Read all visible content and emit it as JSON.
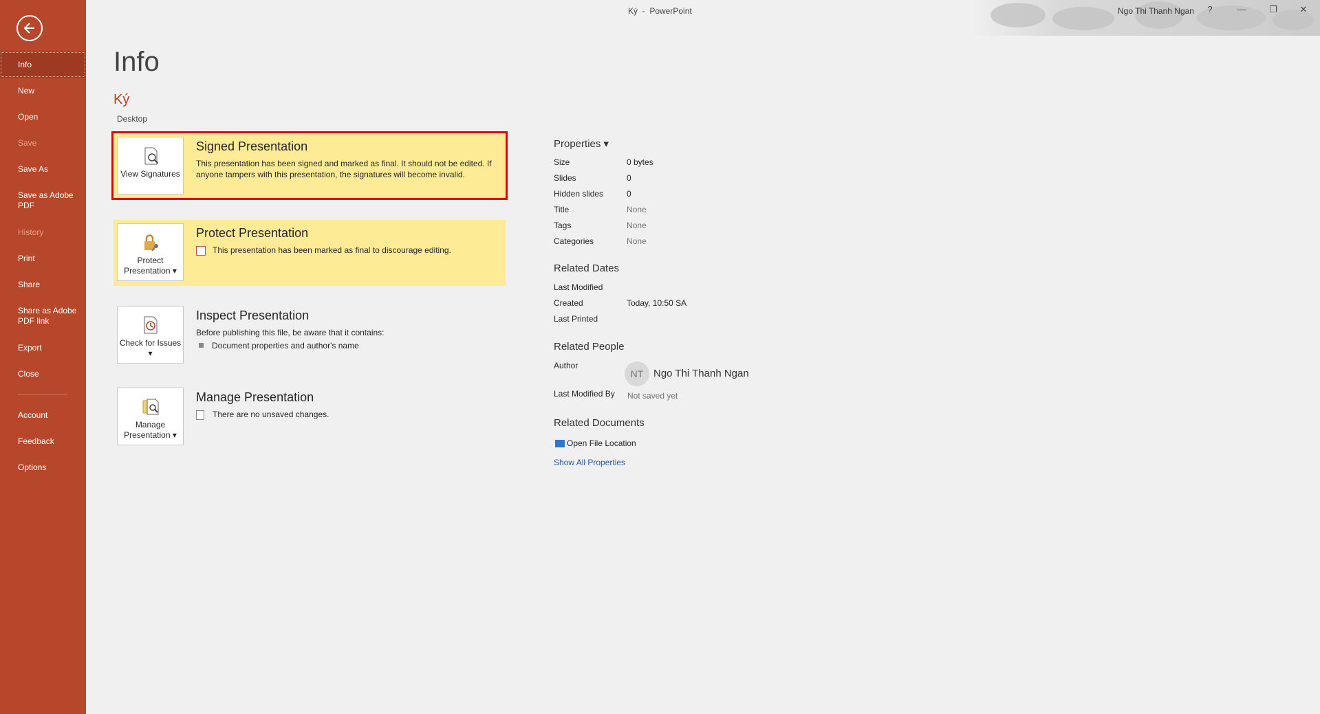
{
  "window": {
    "title": "Ký  -  PowerPoint",
    "user": "Ngo Thi Thanh Ngan",
    "help": "?",
    "minimize": "—",
    "restore": "❐",
    "close": "✕"
  },
  "nav": {
    "items": [
      {
        "label": "Info"
      },
      {
        "label": "New"
      },
      {
        "label": "Open"
      },
      {
        "label": "Save"
      },
      {
        "label": "Save As"
      },
      {
        "label": "Save as Adobe PDF"
      },
      {
        "label": "History"
      },
      {
        "label": "Print"
      },
      {
        "label": "Share"
      },
      {
        "label": "Share as Adobe PDF link"
      },
      {
        "label": "Export"
      },
      {
        "label": "Close"
      },
      {
        "label": "Account"
      },
      {
        "label": "Feedback"
      },
      {
        "label": "Options"
      }
    ]
  },
  "page": {
    "title": "Info",
    "file_name": "Ký",
    "location": "Desktop"
  },
  "sections": {
    "signed": {
      "button": "View Signatures",
      "title": "Signed Presentation",
      "body": "This presentation has been signed and marked as final. It should not be edited. If anyone tampers with this presentation, the signatures will become invalid."
    },
    "protect": {
      "button": "Protect Presentation ▾",
      "title": "Protect Presentation",
      "body": "This presentation has been marked as final to discourage editing."
    },
    "inspect": {
      "button": "Check for Issues ▾",
      "title": "Inspect Presentation",
      "body": "Before publishing this file, be aware that it contains:",
      "bullet": "Document properties and author's name"
    },
    "manage": {
      "button": "Manage Presentation ▾",
      "title": "Manage Presentation",
      "body": "There are no unsaved changes."
    }
  },
  "properties": {
    "heading": "Properties ▾",
    "size_label": "Size",
    "size": "0 bytes",
    "slides_label": "Slides",
    "slides": "0",
    "hidden_label": "Hidden slides",
    "hidden": "0",
    "title_label": "Title",
    "title": "None",
    "tags_label": "Tags",
    "tags": "None",
    "categories_label": "Categories",
    "categories": "None"
  },
  "dates": {
    "heading": "Related Dates",
    "last_modified_label": "Last Modified",
    "created_label": "Created",
    "created": "Today, 10:50 SA",
    "last_printed_label": "Last Printed"
  },
  "people": {
    "heading": "Related People",
    "author_label": "Author",
    "author_initials": "NT",
    "author": "Ngo Thi Thanh Ngan",
    "last_modified_by_label": "Last Modified By",
    "last_modified_by": "Not saved yet"
  },
  "documents": {
    "heading": "Related Documents",
    "open_location": "Open File Location",
    "show_all": "Show All Properties"
  },
  "colors": {
    "nav_bg": "#b7472a",
    "accent": "#c43e1c",
    "highlight_yellow": "#fdeb96",
    "alert_red": "#e00000",
    "link": "#2b579a"
  }
}
